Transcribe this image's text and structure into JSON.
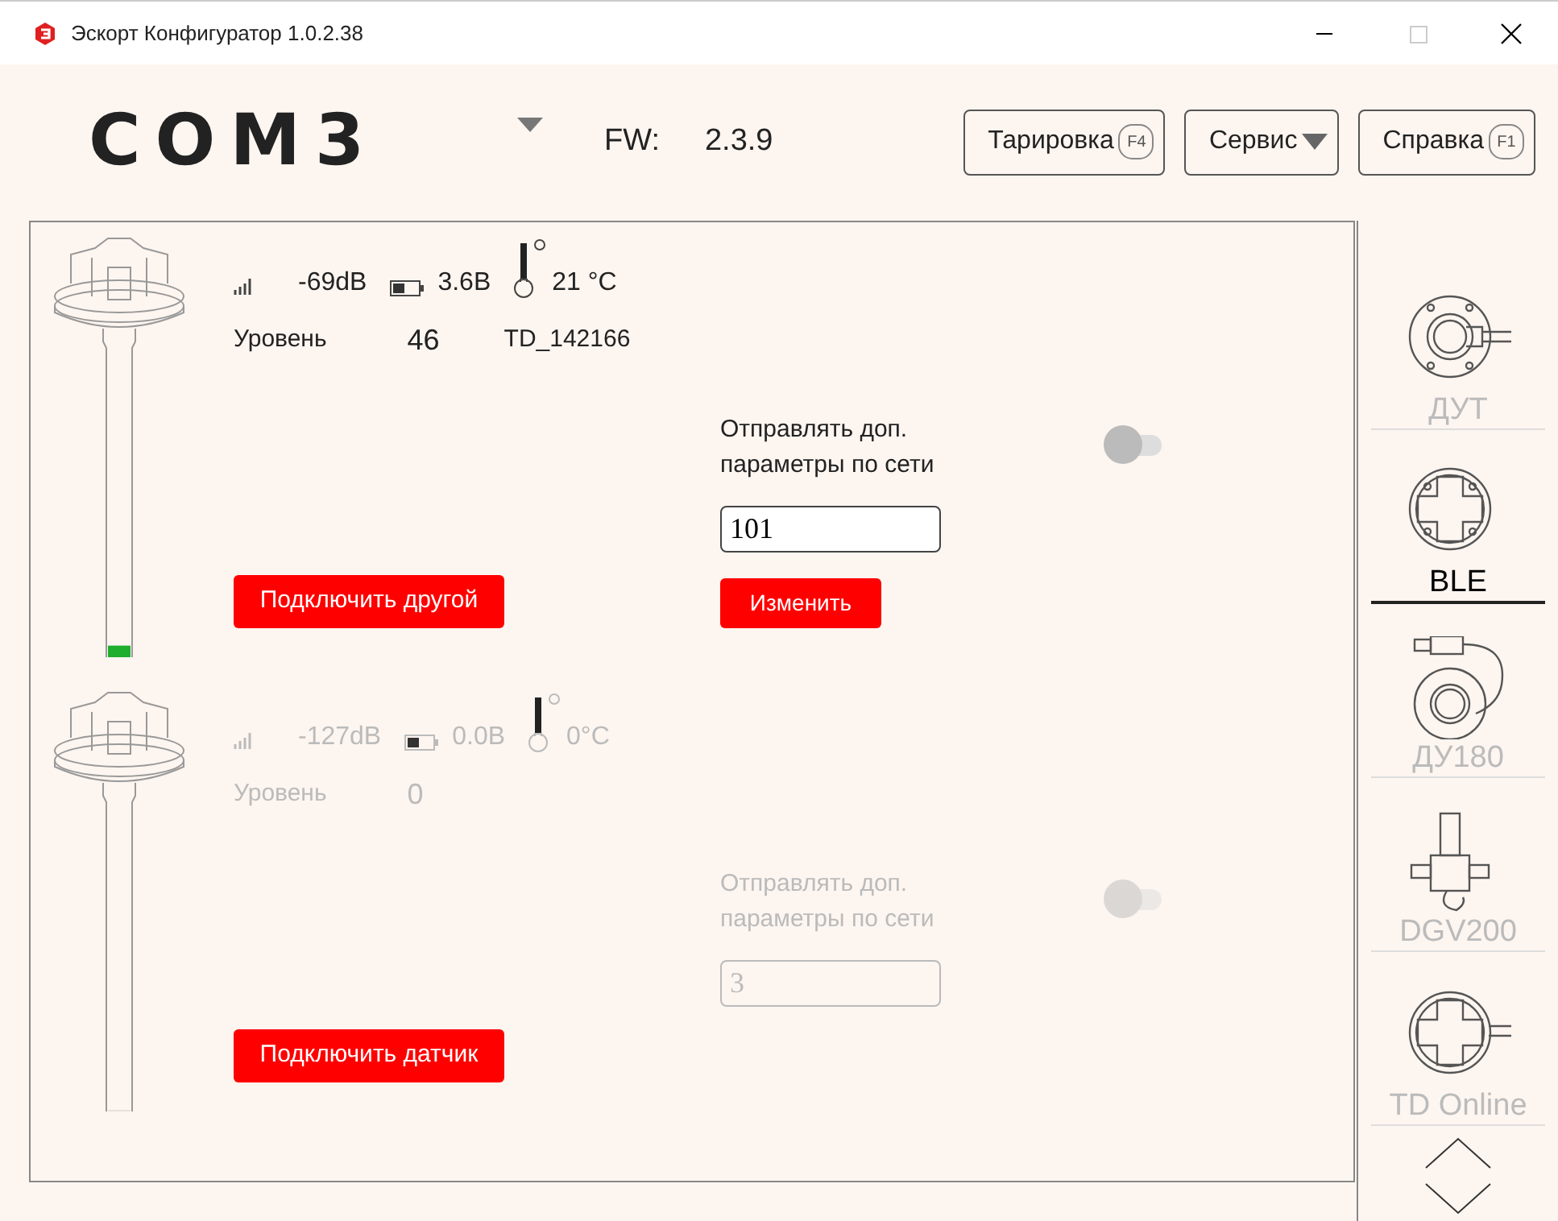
{
  "window": {
    "title": "Эскорт Конфигуратор 1.0.2.38"
  },
  "header": {
    "port": "COM3",
    "fw_label": "FW:",
    "fw_value": "2.3.9",
    "buttons": [
      {
        "label": "Тарировка",
        "kind": "key",
        "key": "F4"
      },
      {
        "label": "Сервис",
        "kind": "dropdown"
      },
      {
        "label": "Справка",
        "kind": "key",
        "key": "F1"
      }
    ]
  },
  "sensors": [
    {
      "active": true,
      "signal": "-69dB",
      "battery": "3.6В",
      "temperature": "21 °C",
      "level_label": "Уровень",
      "level_value": "46",
      "name": "TD_142166",
      "level": 0.03,
      "connect_button": "Подключить другой",
      "send_label": "Отправлять доп. параметры по сети",
      "send_on": false,
      "network_value": "101",
      "change_button": "Изменить"
    },
    {
      "active": false,
      "signal": "-127dB",
      "battery": "0.0В",
      "temperature": "0°C",
      "level_label": "Уровень",
      "level_value": "0",
      "level": 0,
      "connect_button": "Подключить датчик",
      "send_label": "Отправлять доп. параметры по сети",
      "send_on": false,
      "network_value": "3"
    }
  ],
  "sidebar": {
    "items": [
      {
        "label": "ДУТ",
        "kind": "dut",
        "selected": false
      },
      {
        "label": "BLE",
        "kind": "ble",
        "selected": true
      },
      {
        "label": "ДУ180",
        "kind": "du180",
        "selected": false
      },
      {
        "label": "DGV200",
        "kind": "dgv",
        "selected": false
      },
      {
        "label": "TD Online",
        "kind": "td",
        "selected": false
      }
    ]
  }
}
